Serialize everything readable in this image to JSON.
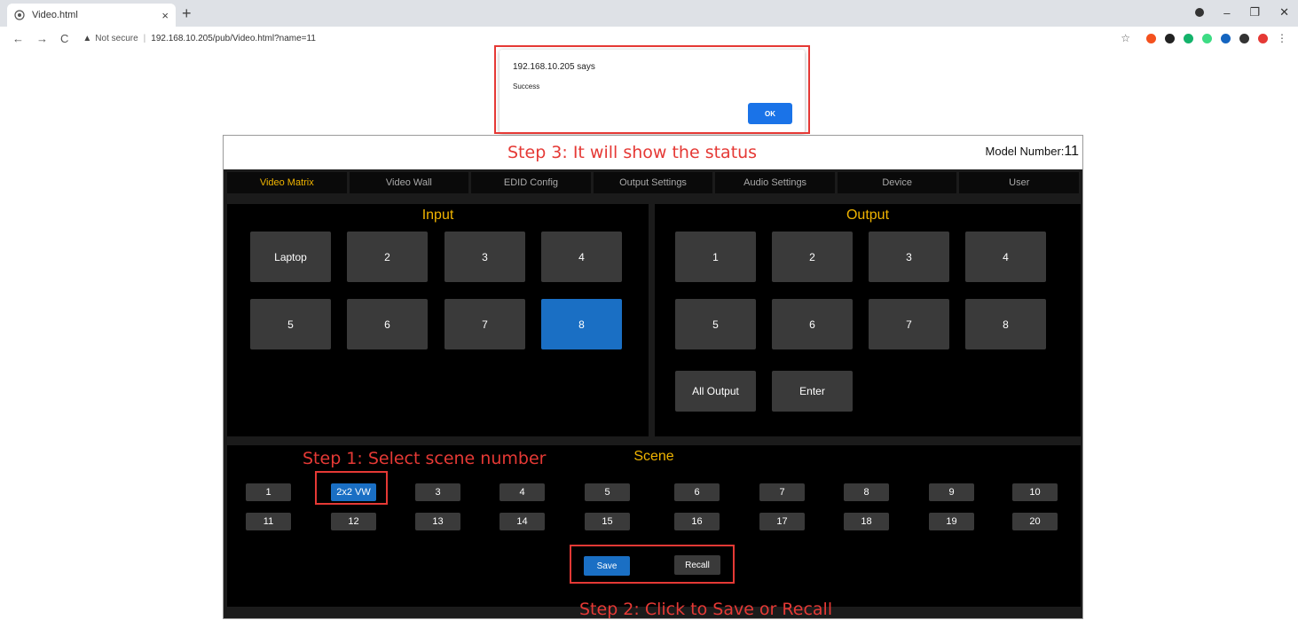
{
  "browser": {
    "tab_title": "Video.html",
    "tab_close": "×",
    "new_tab": "+",
    "security_label": "Not secure",
    "url": "192.168.10.205/pub/Video.html?name=11"
  },
  "dialog": {
    "origin": "192.168.10.205 says",
    "message": "Success",
    "ok_label": "OK"
  },
  "annotations": {
    "step1": "Step 1: Select scene number",
    "step2": "Step 2: Click to Save or Recall",
    "step3": "Step 3: It will show the status",
    "color": "#e53935"
  },
  "header": {
    "model_label": "Model Number:",
    "model_number": "11"
  },
  "menu": [
    {
      "label": "Video Matrix",
      "active": true
    },
    {
      "label": "Video Wall"
    },
    {
      "label": "EDID Config"
    },
    {
      "label": "Output Settings"
    },
    {
      "label": "Audio Settings"
    },
    {
      "label": "Device"
    },
    {
      "label": "User"
    }
  ],
  "input": {
    "title": "Input",
    "buttons": [
      "Laptop",
      "2",
      "3",
      "4",
      "5",
      "6",
      "7",
      "8"
    ],
    "selected_index": 7
  },
  "output": {
    "title": "Output",
    "buttons": [
      "1",
      "2",
      "3",
      "4",
      "5",
      "6",
      "7",
      "8"
    ],
    "all_output_label": "All Output",
    "enter_label": "Enter"
  },
  "scene": {
    "title": "Scene",
    "buttons": [
      "1",
      "2x2 VW",
      "3",
      "4",
      "5",
      "6",
      "7",
      "8",
      "9",
      "10",
      "11",
      "12",
      "13",
      "14",
      "15",
      "16",
      "17",
      "18",
      "19",
      "20"
    ],
    "selected_index": 1,
    "save_label": "Save",
    "recall_label": "Recall"
  },
  "colors": {
    "accent": "#f0b400",
    "selected": "#1a6fc4",
    "button": "#3a3a3a"
  }
}
